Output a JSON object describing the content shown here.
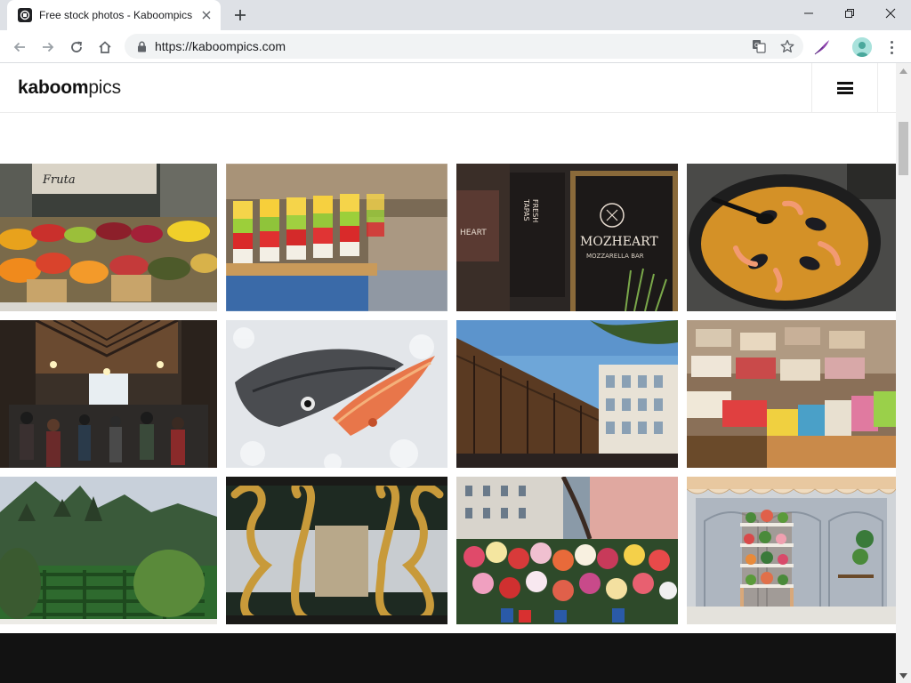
{
  "browser": {
    "tab_title": "Free stock photos - Kaboompics",
    "url": "https://kaboompics.com",
    "new_tab_icon": "plus-icon",
    "window_controls": [
      "minimize-icon",
      "maximize-icon",
      "close-icon"
    ]
  },
  "site": {
    "logo_bold": "kaboom",
    "logo_light": "pics",
    "menu_icon": "hamburger-icon"
  },
  "photos": [
    {
      "subject": "fruit-market-stall"
    },
    {
      "subject": "fruit-skewers"
    },
    {
      "subject": "mozheart-mozzarella-bar-sign"
    },
    {
      "subject": "seafood-paella"
    },
    {
      "subject": "market-hall-interior"
    },
    {
      "subject": "fish-on-ice"
    },
    {
      "subject": "market-building-facade"
    },
    {
      "subject": "used-books-stall"
    },
    {
      "subject": "hedge-maze-garden"
    },
    {
      "subject": "golden-ornate-gate"
    },
    {
      "subject": "flower-market"
    },
    {
      "subject": "flower-shop-storefront"
    }
  ],
  "sign_text": {
    "mozheart": "MOZHEART",
    "mozzarella": "MOZZARELLA BAR",
    "tapas": "TAPAS",
    "fresh": "FRESH",
    "heart": "HEART",
    "fruta": "Fruta"
  },
  "colors": {
    "footer": "#121212",
    "tabstrip": "#dee1e6"
  }
}
